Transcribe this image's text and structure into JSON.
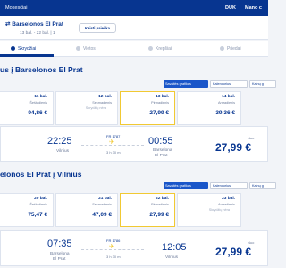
{
  "header": {
    "fees_link": "Mokesčiai",
    "language": "DUK",
    "account": "Mano c"
  },
  "route": {
    "title": "Barselonos El Prat",
    "subtitle": "13 bal. - 22 bal.  |  1",
    "change_button": "Keisti paieška"
  },
  "steps": [
    "Skrydžiai",
    "Vietos",
    "Krepšiai",
    "Priedai"
  ],
  "view": {
    "grid": "Savaitės grafikas",
    "calendar": "Kalendorius",
    "table": "Kainų g"
  },
  "outbound": {
    "title": "us į Barselonos El Prat",
    "dates": [
      {
        "date": "11 bal.",
        "weekday": "Šeštadienis",
        "price": "94,86 €"
      },
      {
        "date": "12 bal.",
        "weekday": "Sekmadienis",
        "unavailable": "Skrydžių nėra"
      },
      {
        "date": "13 bal.",
        "weekday": "Pirmadienis",
        "price": "27,99 €"
      },
      {
        "date": "14 bal.",
        "weekday": "Antradienis",
        "price": "39,36 €"
      }
    ],
    "flight": {
      "depart_time": "22:25",
      "depart_city": "Vilnius",
      "flight_no": "FR 1787",
      "duration": "3 h 30 m",
      "arrive_time": "00:55",
      "arrive_city_1": "Barselona",
      "arrive_city_2": "El Prat",
      "from_label": "Nuo",
      "price": "27,99 €"
    }
  },
  "inbound": {
    "title": "elonos El Prat į Vilnius",
    "dates": [
      {
        "date": "20 bal.",
        "weekday": "Šeštadienis",
        "price": "75,47 €"
      },
      {
        "date": "21 bal.",
        "weekday": "Sekmadienis",
        "price": "47,09 €"
      },
      {
        "date": "22 bal.",
        "weekday": "Pirmadienis",
        "price": "27,99 €"
      },
      {
        "date": "23 bal.",
        "weekday": "Antradienis",
        "unavailable": "Skrydžių nėra"
      }
    ],
    "flight": {
      "depart_time": "07:35",
      "depart_city_1": "Barselona",
      "depart_city_2": "El Prat",
      "flight_no": "FR 1786",
      "duration": "3 h 30 m",
      "arrive_time": "12:05",
      "arrive_city": "Vilnius",
      "from_label": "Nuo",
      "price": "27,99 €"
    }
  },
  "colors": {
    "brand": "#073590",
    "accent": "#f1c933",
    "active_button": "#1a56c9"
  },
  "icons": [
    "plane-icon",
    "person-icon",
    "bag-icon",
    "seat-icon",
    "calendar-icon",
    "grid-icon"
  ]
}
